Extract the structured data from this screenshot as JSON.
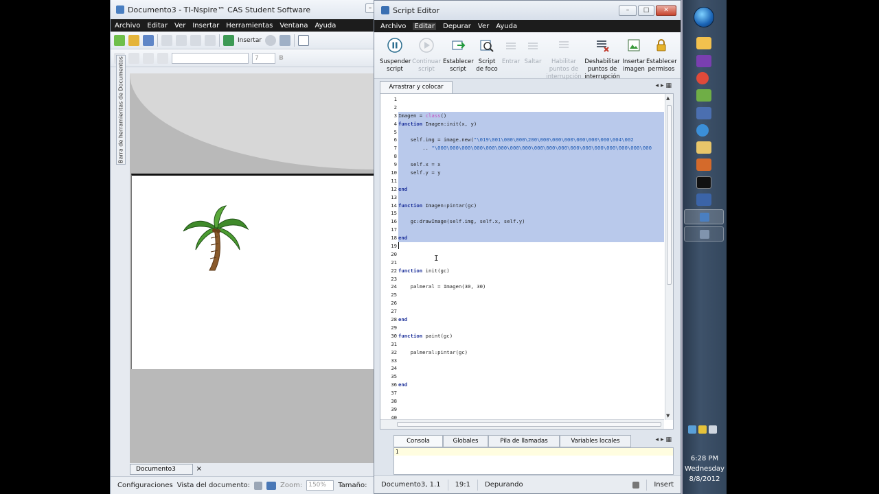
{
  "main_window": {
    "title": "Documento3 - TI-Nspire™ CAS Student Software",
    "menu": [
      "Archivo",
      "Editar",
      "Ver",
      "Insertar",
      "Herramientas",
      "Ventana",
      "Ayuda"
    ],
    "toolbar_insert_label": "Insertar",
    "font_size_value": "7",
    "side_tab_label": "Barra de herramientas de Documentos",
    "doc_tab_label": "Documento3",
    "status": {
      "config_label": "Configuraciones",
      "view_label": "Vista del documento:",
      "zoom_label": "Zoom:",
      "zoom_value": "150%",
      "size_label": "Tamaño:"
    }
  },
  "script_editor": {
    "title": "Script Editor",
    "menu": [
      "Archivo",
      "Editar",
      "Depurar",
      "Ver",
      "Ayuda"
    ],
    "toolbar": [
      {
        "line1": "Suspender",
        "line2": "script",
        "line3": "",
        "enabled": true,
        "icon": "pause-icon"
      },
      {
        "line1": "Continuar",
        "line2": "script",
        "line3": "",
        "enabled": false,
        "icon": "play-icon"
      },
      {
        "line1": "Establecer",
        "line2": "script",
        "line3": "",
        "enabled": true,
        "icon": "set-script-icon"
      },
      {
        "line1": "Script",
        "line2": "de foco",
        "line3": "",
        "enabled": true,
        "icon": "focus-script-icon"
      },
      {
        "line1": "Entrar",
        "line2": "",
        "line3": "",
        "enabled": false,
        "icon": "step-into-icon"
      },
      {
        "line1": "Saltar",
        "line2": "",
        "line3": "",
        "enabled": false,
        "icon": "step-over-icon"
      },
      {
        "line1": "Habilitar",
        "line2": "puntos de",
        "line3": "interrupción",
        "enabled": false,
        "icon": "enable-breakpoints-icon"
      },
      {
        "line1": "Deshabilitar",
        "line2": "puntos de",
        "line3": "interrupción",
        "enabled": true,
        "icon": "disable-breakpoints-icon"
      },
      {
        "line1": "Insertar",
        "line2": "imagen",
        "line3": "",
        "enabled": true,
        "icon": "insert-image-icon"
      },
      {
        "line1": "Establecer",
        "line2": "permisos",
        "line3": "",
        "enabled": true,
        "icon": "lock-icon"
      }
    ],
    "code_tab": "Arrastrar y colocar",
    "code_lines": [
      "",
      "",
      "Imagen = class()",
      "function Imagen:init(x, y)",
      "",
      "    self.img = image.new(\"\\019\\001\\000\\000\\200\\000\\000\\000\\000\\000\\000\\004\\002",
      "        .. \"\\000\\000\\000\\000\\000\\000\\000\\000\\000\\000\\000\\000\\000\\000\\000\\000\\000\\000",
      "",
      "    self.x = x",
      "    self.y = y",
      "",
      "end",
      "",
      "function Imagen:pintar(gc)",
      "",
      "    gc:drawImage(self.img, self.x, self.y)",
      "",
      "end",
      "",
      "",
      "",
      "function init(gc)",
      "",
      "    palmeral = Imagen(30, 30)",
      "",
      "",
      "",
      "end",
      "",
      "function paint(gc)",
      "",
      "    palmeral:pintar(gc)",
      "",
      "",
      "",
      "end",
      "",
      "",
      "",
      ""
    ],
    "console_tabs": [
      "Consola",
      "Globales",
      "Pila de llamadas",
      "Variables locales"
    ],
    "console_line_number": "1",
    "status": {
      "document": "Documento3, 1.1",
      "position": "19:1",
      "mode": "Depurando",
      "insert": "Insert"
    }
  },
  "taskbar": {
    "time": "6:28 PM",
    "day": "Wednesday",
    "date": "8/8/2012"
  }
}
